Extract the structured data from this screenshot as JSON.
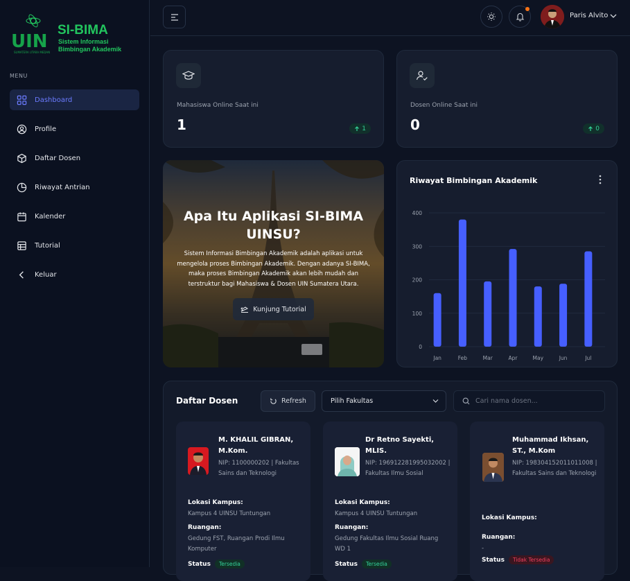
{
  "app": {
    "logo_title": "SI-BIMA",
    "logo_sub1": "Sistem Informasi",
    "logo_sub2": "Bimbingan Akademik",
    "logo_mark": "UIN",
    "logo_small": "SUMATERA UTARA MEDAN"
  },
  "sidebar": {
    "menu_title": "MENU",
    "items": [
      {
        "label": "Dashboard",
        "icon": "grid-icon",
        "active": true
      },
      {
        "label": "Profile",
        "icon": "user-circle-icon"
      },
      {
        "label": "Daftar Dosen",
        "icon": "cube-icon"
      },
      {
        "label": "Riwayat Antrian",
        "icon": "pie-chart-icon"
      },
      {
        "label": "Kalender",
        "icon": "calendar-icon"
      },
      {
        "label": "Tutorial",
        "icon": "table-icon"
      },
      {
        "label": "Keluar",
        "icon": "chevron-left-icon"
      }
    ]
  },
  "topbar": {
    "user_name": "Paris Alvito",
    "has_notification": true
  },
  "stats": [
    {
      "label": "Mahasiswa Online Saat ini",
      "value": "1",
      "badge": "1",
      "icon": "graduation-cap-icon"
    },
    {
      "label": "Dosen Online Saat ini",
      "value": "0",
      "badge": "0",
      "icon": "user-check-icon"
    }
  ],
  "hero": {
    "title": "Apa Itu Aplikasi SI-BIMA UINSU?",
    "text": "Sistem Informasi Bimbingan Akademik adalah aplikasi untuk mengelola proses Bimbingan Akademik. Dengan adanya SI-BIMA, maka proses Bimbingan Akademik akan lebih mudah dan terstruktur bagi Mahasiswa & Dosen UIN Sumatera Utara.",
    "button": "Kunjung Tutorial"
  },
  "chart_data": {
    "type": "bar",
    "title": "Riwayat Bimbingan Akademik",
    "categories": [
      "Jan",
      "Feb",
      "Mar",
      "Apr",
      "May",
      "Jun",
      "Jul"
    ],
    "values": [
      160,
      380,
      195,
      292,
      180,
      188,
      285
    ],
    "ylim": [
      0,
      400
    ],
    "yticks": [
      0,
      100,
      200,
      300,
      400
    ],
    "color": "#465fff",
    "grid": true
  },
  "dosen": {
    "title": "Daftar Dosen",
    "refresh": "Refresh",
    "select_value": "Pilih Fakultas",
    "search_placeholder": "Cari nama dosen...",
    "location_label": "Lokasi Kampus:",
    "room_label": "Ruangan:",
    "status_label": "Status",
    "cards": [
      {
        "name": "M. KHALIL GIBRAN, M.Kom.",
        "nip": "NIP: 1100000202 | Fakultas Sains dan Teknologi",
        "location": "Kampus 4 UINSU Tuntungan",
        "room": "Gedung FST, Ruangan Prodi Ilmu Komputer",
        "status": "Tersedia",
        "photo_bg": "#d71920"
      },
      {
        "name": "Dr Retno Sayekti, MLIS.",
        "nip": "NIP: 196912281995032002 | Fakultas Ilmu Sosial",
        "location": "Kampus 4 UINSU Tuntungan",
        "room": "Gedung Fakultas Ilmu Sosial Ruang WD 1",
        "status": "Tersedia",
        "photo_bg": "#f2f2f2"
      },
      {
        "name": "Muhammad Ikhsan, ST., M.Kom",
        "nip": "NIP: 198304152011011008 | Fakultas Sains dan Teknologi",
        "location": "",
        "room": "-",
        "status": "Tidak Tersedia",
        "photo_bg": "#8a5a3a"
      }
    ]
  }
}
